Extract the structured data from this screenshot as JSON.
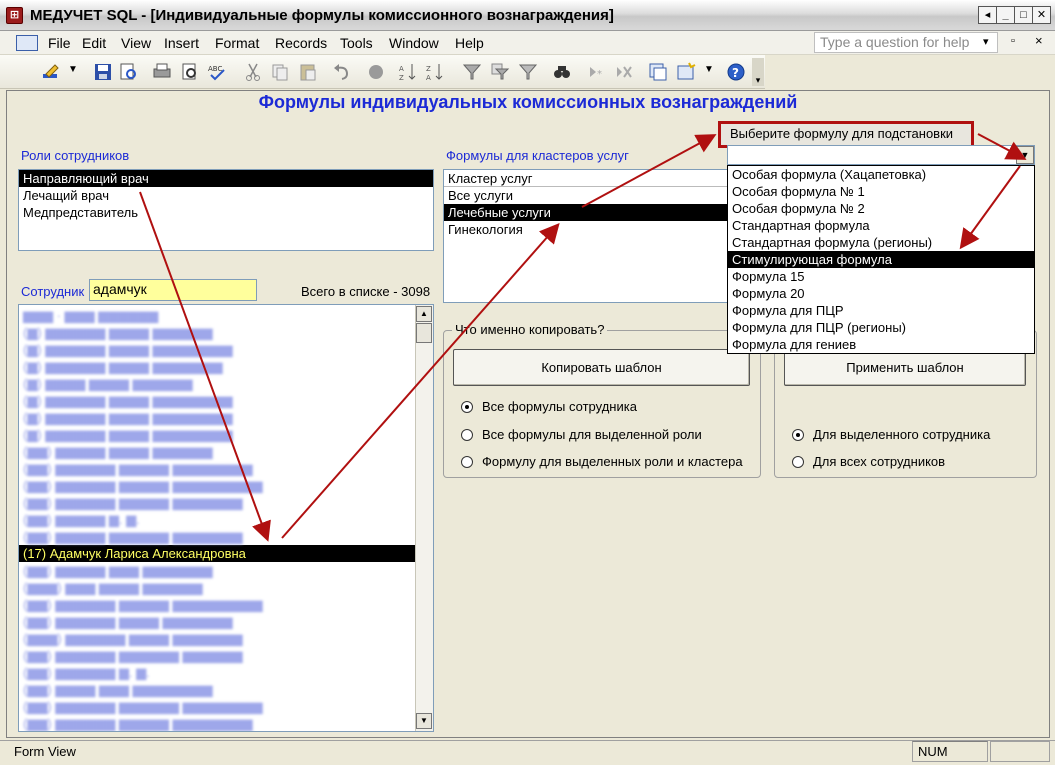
{
  "window": {
    "title": "МЕДУЧЕТ SQL - [Индивидуальные формулы комиссионного вознаграждения]",
    "icon_glyph": "⊞"
  },
  "menu": {
    "items": [
      "File",
      "Edit",
      "View",
      "Insert",
      "Format",
      "Records",
      "Tools",
      "Window",
      "Help"
    ],
    "help_placeholder": "Type a question for help"
  },
  "form": {
    "title": "Формулы индивидуальных комиссионных вознаграждений",
    "roles_label": "Роли сотрудников",
    "roles": [
      "Направляющий врач",
      "Лечащий врач",
      "Медпредставитель"
    ],
    "employee_label": "Сотрудник",
    "employee_value": "адамчук",
    "total_text": "Всего в списке - 3098",
    "employees_selected": "(17) Адамчук Лариса Александровна",
    "clusters_label": "Формулы для кластеров услуг",
    "clusters": [
      "Кластер услуг",
      "Все услуги",
      "Лечебные услуги",
      "Гинекология"
    ],
    "formula_select_label": "Выберите формулу для подстановки",
    "formula_options": [
      "Особая формула (Хацапетовка)",
      "Особая формула № 1",
      "Особая формула № 2",
      "Стандартная формула",
      "Стандартная формула (регионы)",
      "Стимулирующая формула",
      "Формула 15",
      "Формула 20",
      "Формула для ПЦР",
      "Формула для ПЦР (регионы)",
      "Формула для гениев"
    ],
    "copy_group_label": "Что именно копировать?",
    "copy_button": "Копировать шаблон",
    "apply_button": "Применить шаблон",
    "copy_options": [
      "Все формулы сотрудника",
      "Все формулы для выделенной роли",
      "Формулу для выделенных роли и кластера"
    ],
    "apply_options": [
      "Для выделенного сотрудника",
      "Для всех сотрудников"
    ]
  },
  "status": {
    "mode": "Form View",
    "num": "NUM"
  },
  "colors": {
    "accent_blue": "#1c2ad6",
    "annotation_red": "#b01010",
    "selection": "#000000"
  }
}
